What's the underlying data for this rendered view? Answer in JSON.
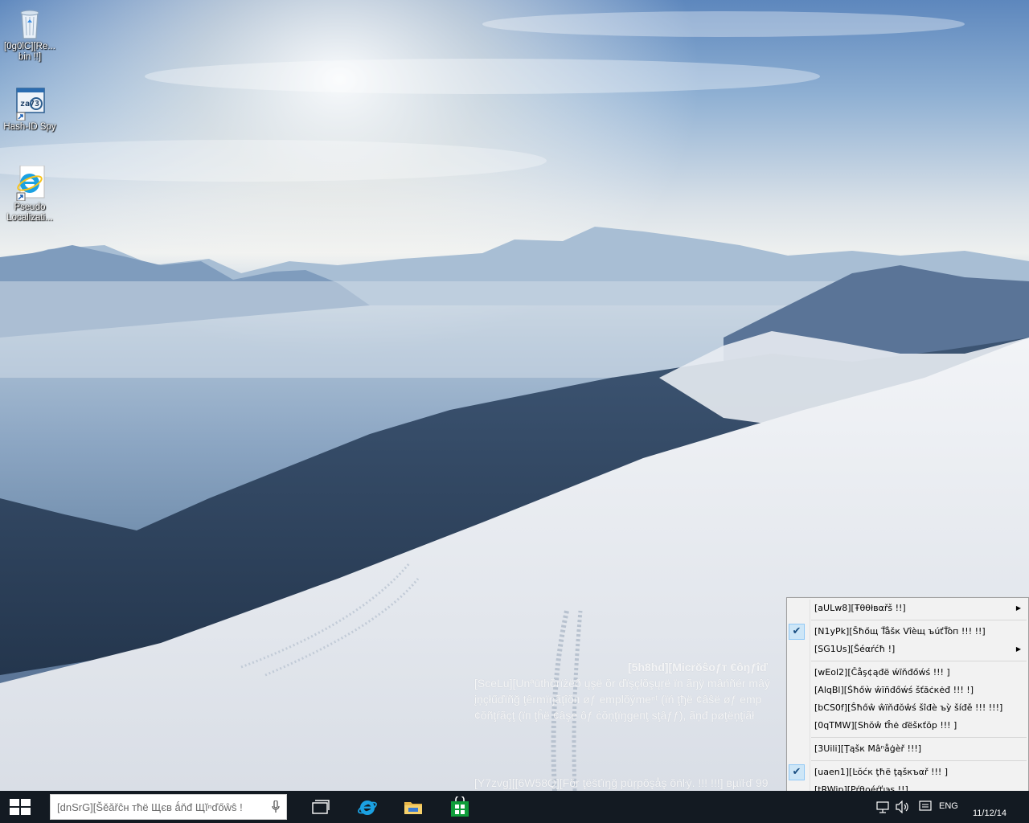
{
  "desktop": {
    "icons": [
      {
        "label": "[0g0lC][Re... bin !!]"
      },
      {
        "label": "Hash-ID Spy"
      },
      {
        "label": "Pseudo Localizati..."
      }
    ]
  },
  "watermark": {
    "title": "[5h8hd][Micrŏŝoƒт €ôŋƒîď",
    "line1": "[SceLu][Unªūthŏrïżëð ųşë ŏr ďïşçłŏşųŗë ïn ãŋÿ mâńñér mâý",
    "line2": "įņçłűďïñğ ţêrmïŋãţîŏп øƒ emplŏýmeⁿᵗ (ïń ţђë ¢âŝë øƒ emp",
    "line3": "¢ŏñţŕãçţ (ïп ţĥë ¢âşe ôƒ ċŏņţïŋgeпţ sţâƒƒ), ãņđ pøţëņţiãł",
    "build": "[Y7zvg][[6W58Q][Fŏr ţëšťïŋğ pūŗpŏşåş ŏńŀý. !!! !!!] вµïŀď 99"
  },
  "context_menu": {
    "items": [
      {
        "label": "[aULw8][Ŧθθłвαřš !!]",
        "submenu": true,
        "checked": false
      },
      {
        "label": "[N1yPk][Šħőщ Ťåšк Vîèщ ъúťŤòп !!! !!]",
        "submenu": false,
        "checked": true
      },
      {
        "label": "[SG1Us][Šéαŕćħ !]",
        "submenu": true,
        "checked": false
      },
      {
        "label": "[wEol2][Čåş¢ąđë ẃĩňđőẃś !!! ]",
        "submenu": false,
        "checked": false
      },
      {
        "label": "[AlqBl][Śħőẁ ŵïñđőẃś šťăċкėđ !!! !]",
        "submenu": false,
        "checked": false
      },
      {
        "label": "[bCS0f][Ŝħőŵ ŵïňđŏŵś šîđè ъỳ šíđě !!! !!!]",
        "submenu": false,
        "checked": false
      },
      {
        "label": "[0qTMW][Shŏŵ ťĥė ďёšкťŏр !!! ]",
        "submenu": false,
        "checked": false
      },
      {
        "label": "[3Uili][Ţąšк Mâⁿåģèř !!!]",
        "submenu": false,
        "checked": false
      },
      {
        "label": "[uaen1][Ŀŏćк ţħë ţąšкъαř !!! ]",
        "submenu": false,
        "checked": true
      },
      {
        "label": "[tRWip][Pŕθρéŕťıэş !!]",
        "submenu": false,
        "checked": false
      }
    ]
  },
  "taskbar": {
    "search_placeholder": "[dnSrG][Šěăřĉн тħë Щєв ǻňđ Щĭⁿďőŵŝ !",
    "language": "ENG",
    "date": "11/12/14"
  },
  "colors": {
    "taskbar": "#131a22",
    "menu_bg": "#f2f2f2",
    "check_bg": "#cde6f7",
    "windows_blue": "#1ba1e2",
    "store_green": "#0f9d3a"
  }
}
